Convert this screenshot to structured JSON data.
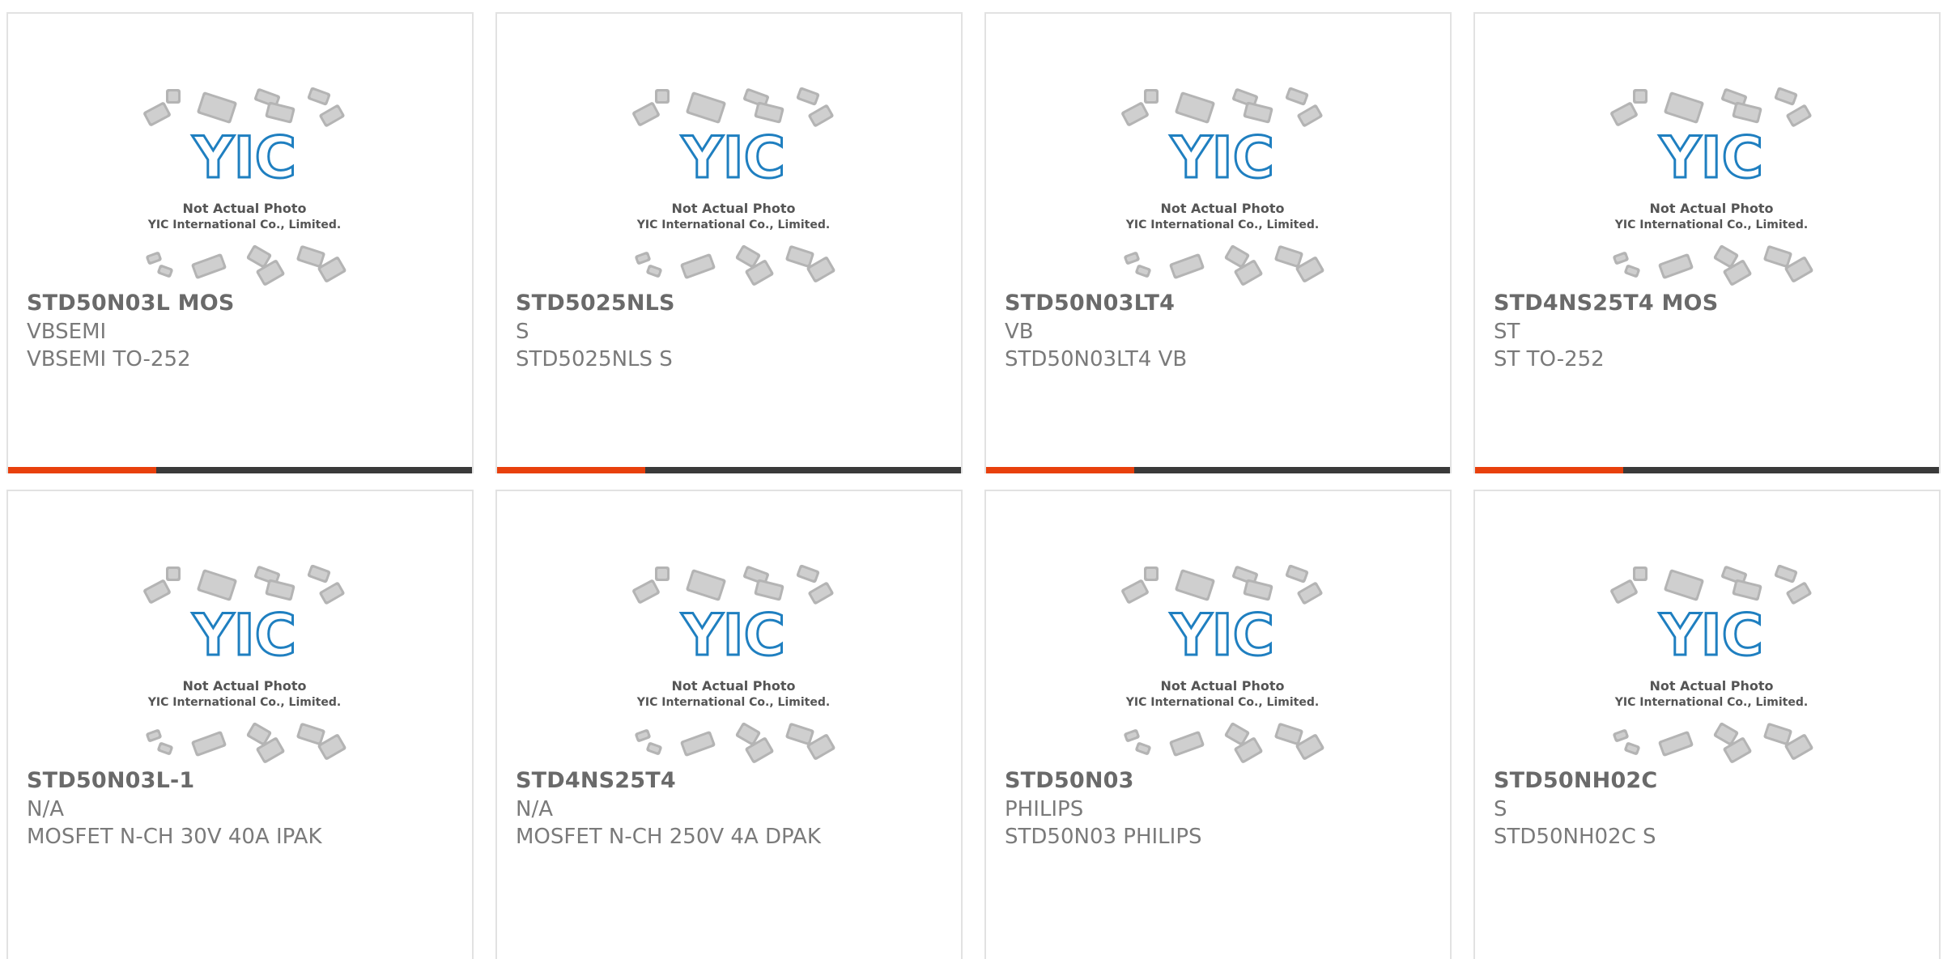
{
  "colors": {
    "accent": "#e8400c",
    "bar_dark": "#3a3a3a",
    "logo_blue": "#1f7fc0",
    "chip_gray": "#b4b4b4"
  },
  "placeholder": {
    "icon": "yic-logo-chip-collage",
    "line1": "Not Actual Photo",
    "line2": "YIC International Co., Limited."
  },
  "progress_accent_fraction": 0.32,
  "products": [
    {
      "part": "STD50N03L MOS",
      "brand": "VBSEMI",
      "desc": "VBSEMI TO-252"
    },
    {
      "part": "STD5025NLS",
      "brand": "S",
      "desc": "STD5025NLS S"
    },
    {
      "part": "STD50N03LT4",
      "brand": "VB",
      "desc": "STD50N03LT4 VB"
    },
    {
      "part": "STD4NS25T4 MOS",
      "brand": "ST",
      "desc": "ST TO-252"
    },
    {
      "part": "STD50N03L-1",
      "brand": "N/A",
      "desc": "MOSFET N-CH 30V 40A IPAK"
    },
    {
      "part": "STD4NS25T4",
      "brand": "N/A",
      "desc": "MOSFET N-CH 250V 4A DPAK"
    },
    {
      "part": "STD50N03",
      "brand": "PHILIPS",
      "desc": "STD50N03 PHILIPS"
    },
    {
      "part": "STD50NH02C",
      "brand": "S",
      "desc": "STD50NH02C S"
    }
  ]
}
